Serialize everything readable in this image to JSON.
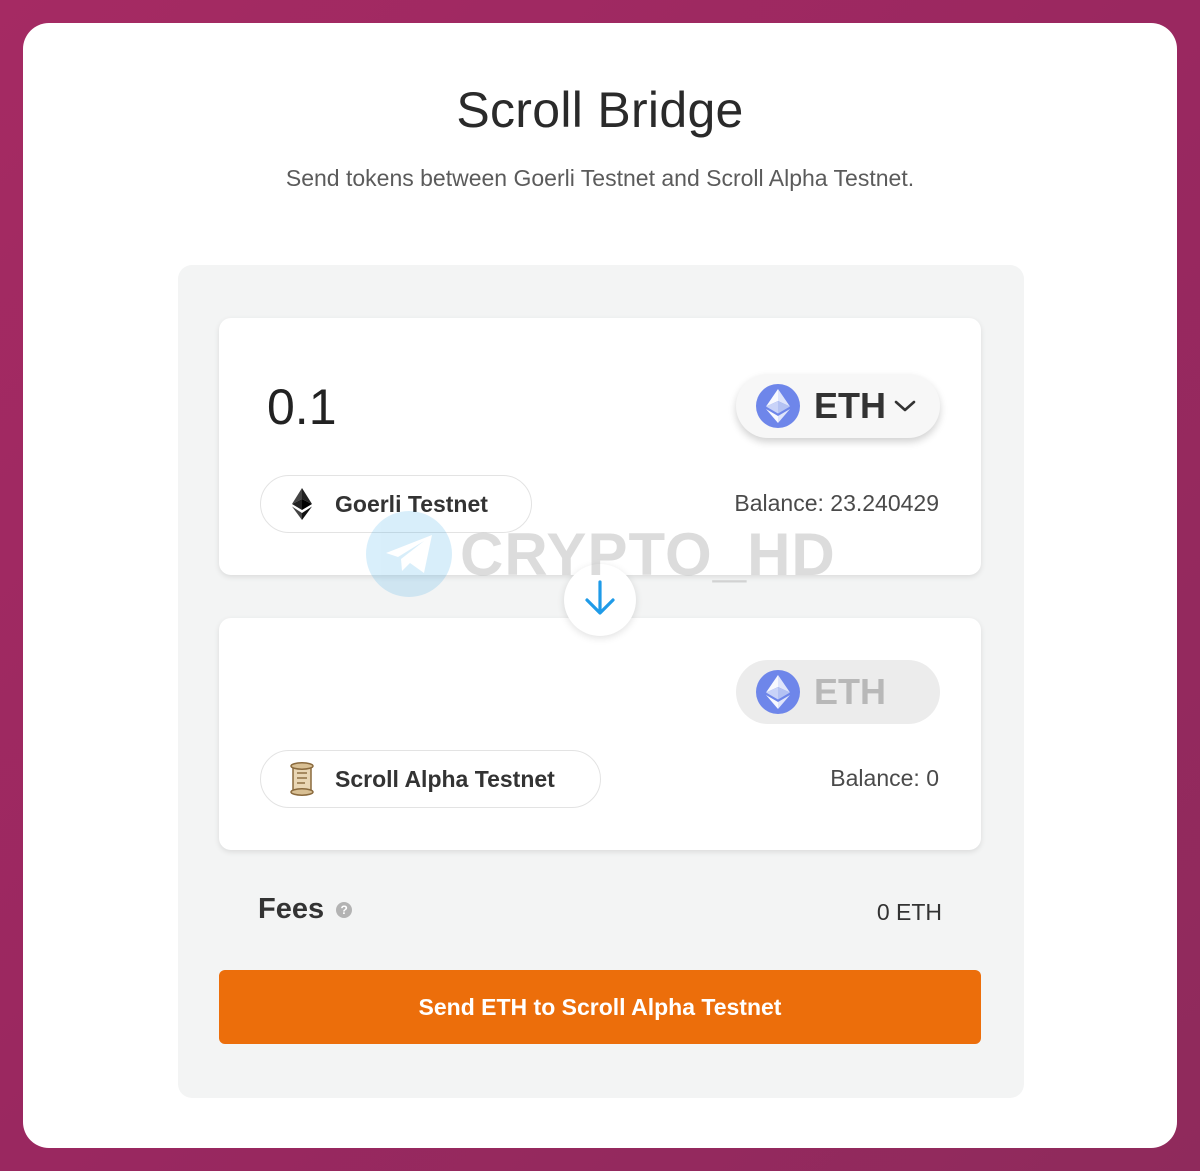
{
  "header": {
    "title": "Scroll Bridge",
    "subtitle": "Send tokens between Goerli Testnet and Scroll Alpha Testnet."
  },
  "from": {
    "amount": "0.1",
    "token": "ETH",
    "network": "Goerli Testnet",
    "balance": "Balance: 23.240429"
  },
  "to": {
    "token": "ETH",
    "network": "Scroll Alpha Testnet",
    "balance": "Balance: 0"
  },
  "fees": {
    "label": "Fees",
    "help": "?",
    "value": "0 ETH"
  },
  "action": {
    "send_label": "Send ETH to Scroll Alpha Testnet"
  },
  "watermark": {
    "text": "CRYPTO_HD"
  },
  "colors": {
    "accent": "#ec6e0b",
    "eth": "#6e86ea",
    "arrow": "#1f9be8",
    "background": "#a52a63"
  },
  "icons": {
    "token": "ethereum-icon",
    "from_network": "ethereum-icon",
    "to_network": "scroll-icon",
    "swap": "arrow-down-icon",
    "token_dropdown": "chevron-down-icon",
    "fees_help": "help-icon"
  }
}
